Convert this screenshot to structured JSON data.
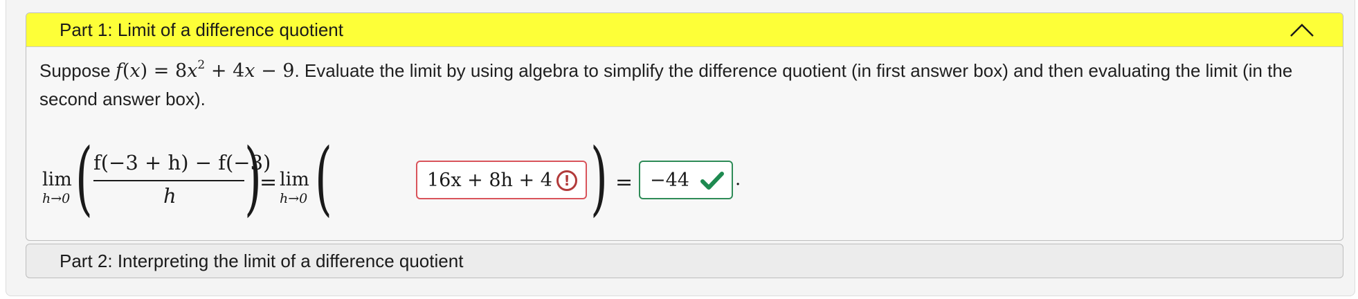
{
  "part1": {
    "title": "Part 1: Limit of a difference quotient",
    "prompt_prefix": "Suppose",
    "function": {
      "f": "f",
      "x": "x",
      "coef_a": "8",
      "var2": "x",
      "exp": "2",
      "plus": "+",
      "coef_b": "4",
      "var1": "x",
      "minus": "−",
      "const": "9"
    },
    "prompt_suffix": ". Evaluate the limit by using algebra to simplify the difference quotient (in first answer box) and then evaluating the limit (in the second answer box).",
    "equation": {
      "lim": "lim",
      "lim_sub": "h→0",
      "numerator": "f(−3 + h) − f(−3)",
      "denominator": "h",
      "equals": "="
    },
    "answer1": {
      "value": "16x + 8h + 4",
      "status": "incorrect",
      "status_icon": "alert-circle-icon"
    },
    "answer2": {
      "value": "−44",
      "status": "correct",
      "status_icon": "checkmark-icon"
    },
    "period": "."
  },
  "part2": {
    "title": "Part 2: Interpreting the limit of a difference quotient"
  },
  "colors": {
    "header_highlight": "#fdff38",
    "incorrect": "#d9535a",
    "correct": "#2e8b57"
  }
}
